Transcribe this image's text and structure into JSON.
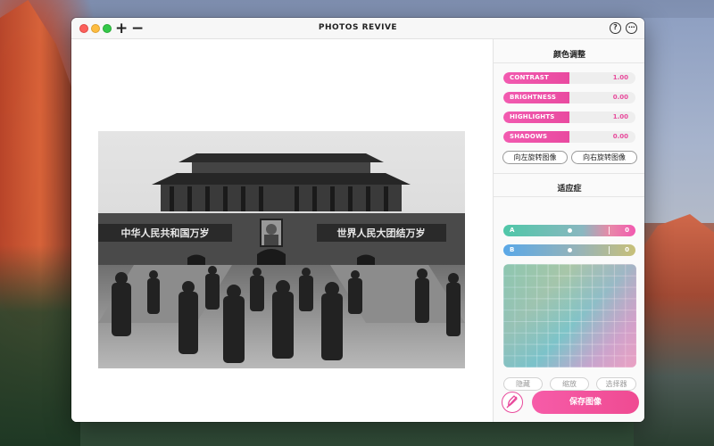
{
  "window": {
    "title": "PHOTOS REVIVE",
    "add_label": "+",
    "remove_label": "−",
    "help_icon_text": "?",
    "more_icon_text": "···"
  },
  "sidebar": {
    "color_section_title": "颜色调整",
    "adjustments": [
      {
        "label": "CONTRAST",
        "value": "1.00",
        "level": 0.5
      },
      {
        "label": "BRIGHTNESS",
        "value": "0.00",
        "level": 0.5
      },
      {
        "label": "HIGHLIGHTS",
        "value": "1.00",
        "level": 0.5
      },
      {
        "label": "SHADOWS",
        "value": "0.00",
        "level": 0.5
      }
    ],
    "rotate_left_label": "向左旋转图像",
    "rotate_right_label": "向右旋转图像",
    "adapt_section_title": "适应症",
    "ab_sliders": [
      {
        "label": "A",
        "value": "0",
        "level": 0.5
      },
      {
        "label": "B",
        "value": "0",
        "level": 0.5
      }
    ],
    "hide_label": "隐藏",
    "zoom_label": "缩放",
    "picker_label": "选择器",
    "save_label": "保存图像"
  },
  "photo": {
    "left_banner": "中华人民共和国万岁",
    "right_banner": "世界人民大团结万岁"
  },
  "colors": {
    "accent": "#ef4b92",
    "accent_light": "#f65ca8"
  }
}
